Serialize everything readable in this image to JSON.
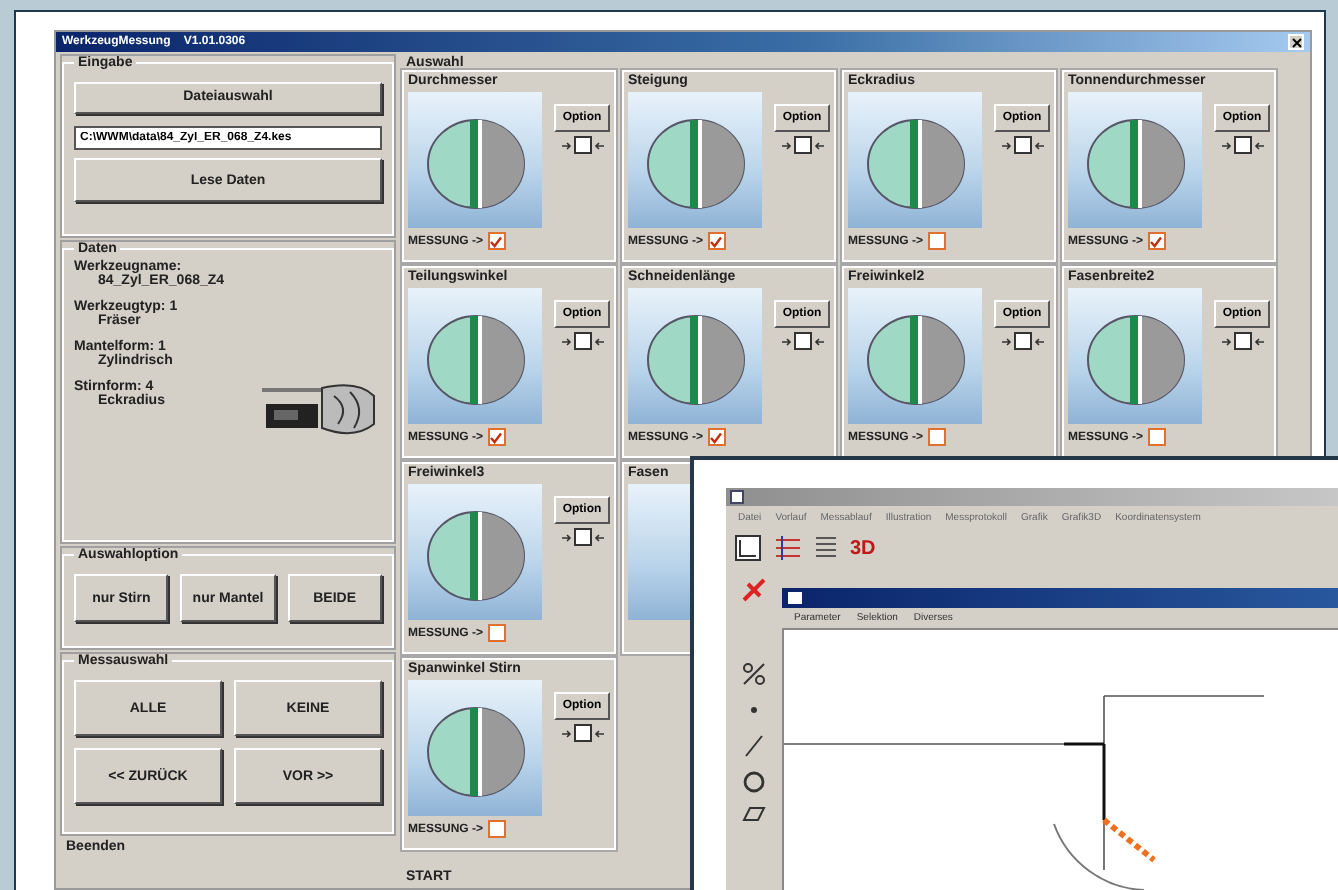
{
  "main_window": {
    "title": "WerkzeugMessung    V1.01.0306",
    "input": {
      "label": "Eingabe",
      "file_button": "Dateiauswahl",
      "file_path": "C:\\WWM\\data\\84_Zyl_ER_068_Z4.kes",
      "read_button": "Lese Daten"
    },
    "data": {
      "label": "Daten",
      "fields": [
        {
          "label": "Werkzeugname:",
          "value": "84_Zyl_ER_068_Z4"
        },
        {
          "label": "Werkzeugtyp: 1",
          "value": "Fräser"
        },
        {
          "label": "Mantelform: 1",
          "value": "Zylindrisch"
        },
        {
          "label": "Stirnform: 4",
          "value": "Eckradius"
        }
      ]
    },
    "selection_option": {
      "label": "Auswahloption",
      "buttons": [
        "nur Stirn",
        "nur Mantel",
        "BEIDE"
      ]
    },
    "measurement_selection": {
      "label": "Messauswahl",
      "buttons": [
        "ALLE",
        "KEINE",
        "<< ZURÜCK",
        "VOR >>"
      ]
    },
    "exit": {
      "label": "Beenden"
    },
    "selection": {
      "label": "Auswahl",
      "cards": [
        {
          "kind": "full",
          "title": "Durchmesser",
          "option_button": "Option",
          "option_checked": false,
          "measure_label": "MESSUNG ->",
          "measure_checked": true
        },
        {
          "kind": "full",
          "title": "Steigung",
          "option_button": "Option",
          "option_checked": false,
          "measure_label": "MESSUNG ->",
          "measure_checked": true
        },
        {
          "kind": "full",
          "title": "Eckradius",
          "option_button": "Option",
          "option_checked": false,
          "measure_label": "MESSUNG ->",
          "measure_checked": false
        },
        {
          "kind": "full",
          "title": "Tonnendurchmesser",
          "option_button": "Option",
          "option_checked": false,
          "measure_label": "MESSUNG ->",
          "measure_checked": true
        },
        {
          "kind": "full",
          "title": "Teilungswinkel",
          "option_button": "Option",
          "option_checked": false,
          "measure_label": "MESSUNG ->",
          "measure_checked": true
        },
        {
          "kind": "full",
          "title": "Schneidenlänge",
          "option_button": "Option",
          "option_checked": false,
          "measure_label": "MESSUNG ->",
          "measure_checked": true
        },
        {
          "kind": "full",
          "title": "Freiwinkel2",
          "option_button": "Option",
          "option_checked": false,
          "measure_label": "MESSUNG ->",
          "measure_checked": false
        },
        {
          "kind": "full",
          "title": "Fasenbreite2",
          "option_button": "Option",
          "option_checked": false,
          "measure_label": "MESSUNG ->",
          "measure_checked": false
        },
        {
          "kind": "full",
          "title": "Freiwinkel3",
          "option_button": "Option",
          "option_checked": false,
          "measure_label": "MESSUNG ->",
          "measure_checked": false
        },
        {
          "kind": "partial",
          "title": "Fasen"
        },
        {
          "kind": "empty"
        },
        {
          "kind": "empty"
        },
        {
          "kind": "full",
          "title": "Spanwinkel Stirn",
          "option_button": "Option",
          "option_checked": false,
          "measure_label": "MESSUNG ->",
          "measure_checked": false
        }
      ]
    },
    "start": {
      "label": "START"
    }
  },
  "cad_window": {
    "menu": [
      "Datei",
      "Vorlauf",
      "Messablauf",
      "Illustration",
      "Messprotokoll",
      "Grafik",
      "Grafik3D",
      "Koordinatensystem"
    ],
    "toolbar_3d": "3D",
    "child_menu": [
      "Parameter",
      "Selektion",
      "Diverses"
    ]
  }
}
